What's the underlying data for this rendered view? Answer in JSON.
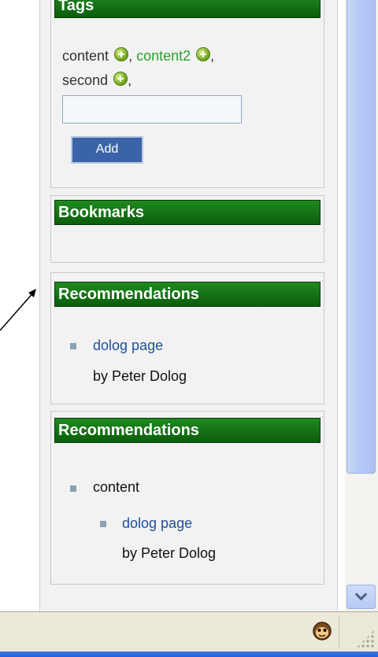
{
  "tags_panel": {
    "title": "Tags",
    "tags": [
      "content",
      "content2",
      "second"
    ],
    "separator": ",",
    "input_value": "",
    "add_label": "Add"
  },
  "bookmarks_panel": {
    "title": "Bookmarks"
  },
  "recommendations_1": {
    "title": "Recommendations",
    "item": {
      "link": "dolog page",
      "author": "by Peter Dolog"
    }
  },
  "recommendations_2": {
    "title": "Recommendations",
    "group": "content",
    "item": {
      "link": "dolog page",
      "author": "by Peter Dolog"
    }
  },
  "status_bar": {
    "icon": "monkey-icon",
    "grip": "resize-grip-icon"
  },
  "colors": {
    "header_green": "#0c5d0c",
    "button_blue": "#3b64a8",
    "link_blue": "#1f4f96",
    "tag_green": "#2f9e2f"
  }
}
